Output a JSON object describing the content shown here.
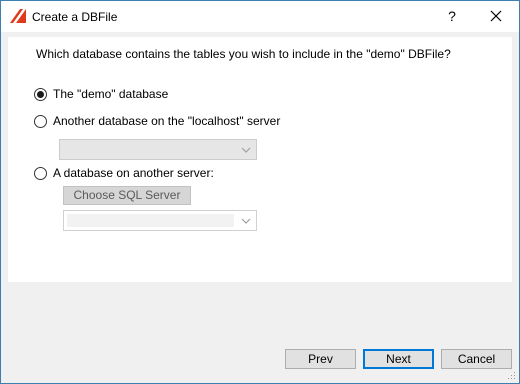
{
  "window": {
    "title": "Create a DBFile",
    "help_label": "?"
  },
  "content": {
    "question": "Which database contains the tables you wish to include in the \"demo\" DBFile?",
    "options": [
      {
        "label": "The \"demo\" database",
        "checked": true
      },
      {
        "label": "Another database on the \"localhost\" server",
        "checked": false
      },
      {
        "label": "A database on another server:",
        "checked": false
      }
    ],
    "localhost_db_select": {
      "value": ""
    },
    "choose_sql_server_label": "Choose SQL Server",
    "remote_db_select": {
      "value": ""
    }
  },
  "footer": {
    "prev_label": "Prev",
    "next_label": "Next",
    "cancel_label": "Cancel"
  },
  "colors": {
    "accent_border": "#0078d7",
    "app_icon_red": "#e03a1e"
  }
}
